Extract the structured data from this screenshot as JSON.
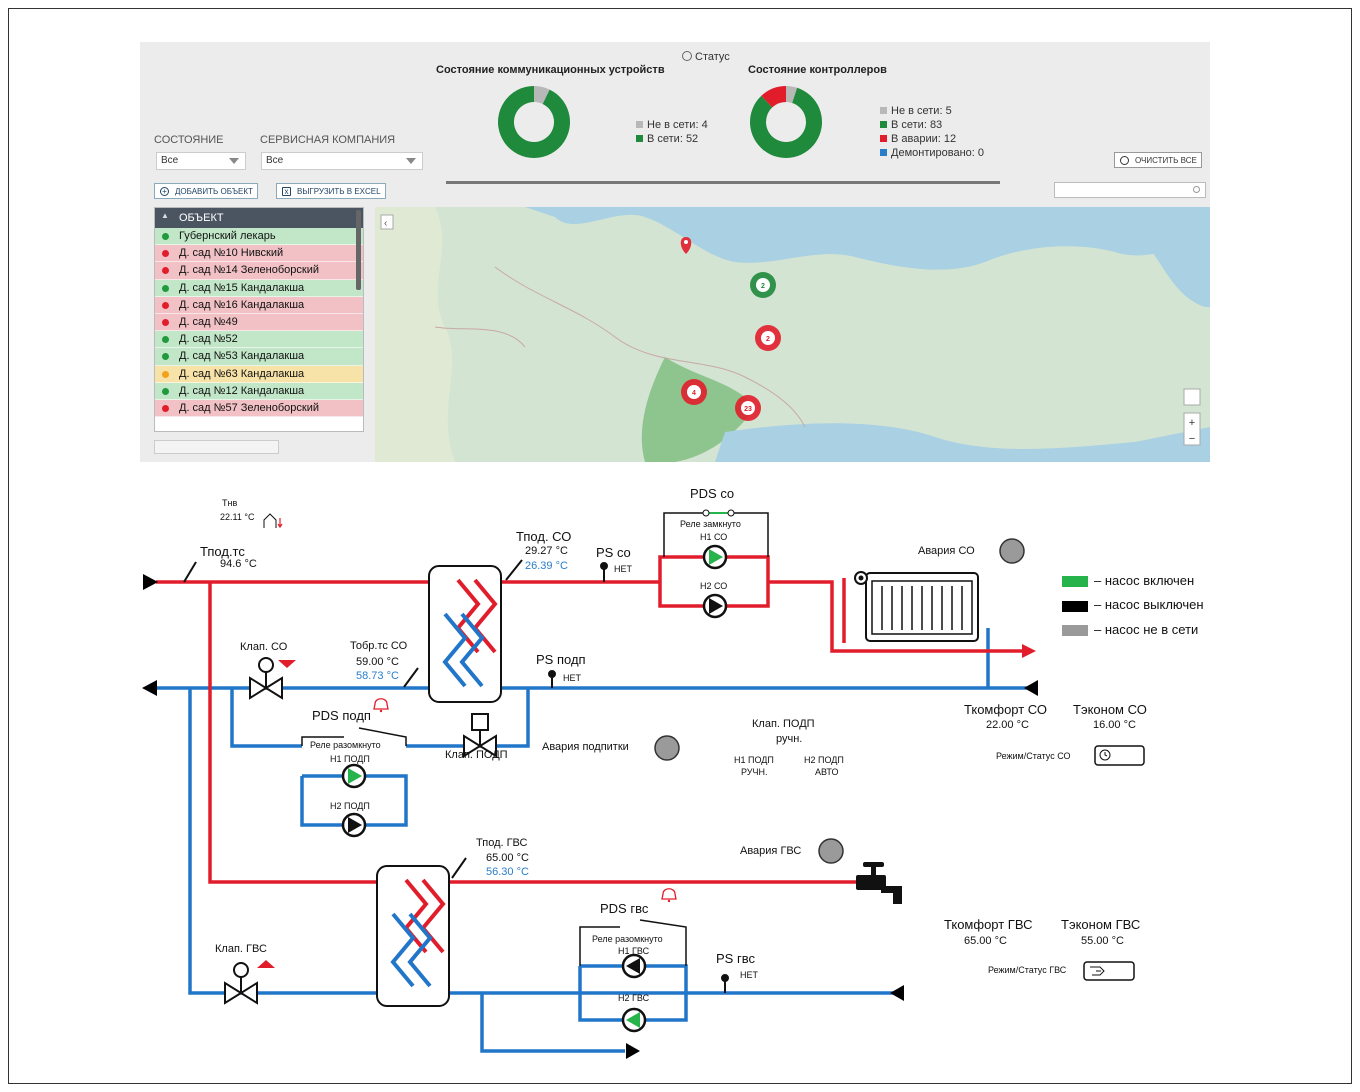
{
  "colors": {
    "supply": "#e21d2b",
    "return": "#2176c9",
    "pump_on": "#27b34b",
    "pump_off": "#000000",
    "pump_offline": "#9a9a9a",
    "alarm_indicator": "#9a9a9a"
  },
  "dashboard": {
    "status_title": "Статус",
    "comm_devices": {
      "title": "Состояние коммуникационных устройств",
      "offline_label": "Не в сети: 4",
      "online_label": "В сети: 52"
    },
    "controllers": {
      "title": "Состояние контроллеров",
      "offline_label": "Не в сети: 5",
      "online_label": "В сети: 83",
      "alarm_label": "В аварии: 12",
      "dismantled_label": "Демонтировано: 0"
    },
    "chart_data": [
      {
        "type": "pie",
        "title": "Состояние коммуникационных устройств",
        "categories": [
          "Не в сети",
          "В сети"
        ],
        "values": [
          4,
          52
        ],
        "colors": [
          "#b8b8b8",
          "#1f8a3c"
        ]
      },
      {
        "type": "pie",
        "title": "Состояние контроллеров",
        "categories": [
          "Не в сети",
          "В сети",
          "В аварии",
          "Демонтировано"
        ],
        "values": [
          5,
          83,
          12,
          0
        ],
        "colors": [
          "#b8b8b8",
          "#1f8a3c",
          "#e21d2b",
          "#2a7ec8"
        ]
      }
    ],
    "filters": {
      "state_label": "СОСТОЯНИЕ",
      "state_value": "Все",
      "company_label": "СЕРВИСНАЯ КОМПАНИЯ",
      "company_value": "Все"
    },
    "add_object_button": "ДОБАВИТЬ ОБЪЕКТ",
    "export_excel_button": "ВЫГРУЗИТЬ В EXCEL",
    "clear_all_button": "ОЧИСТИТЬ ВСЕ",
    "object_column": "ОБЪЕКТ",
    "objects": [
      {
        "name": "Губернский лекарь",
        "status": "green"
      },
      {
        "name": "Д. сад №10 Нивский",
        "status": "red"
      },
      {
        "name": "Д. сад №14 Зеленоборский",
        "status": "red"
      },
      {
        "name": "Д. сад №15 Кандалакша",
        "status": "green"
      },
      {
        "name": "Д. сад №16 Кандалакша",
        "status": "red"
      },
      {
        "name": "Д. сад №49",
        "status": "red"
      },
      {
        "name": "Д. сад №52",
        "status": "green"
      },
      {
        "name": "Д. сад №53 Кандалакша",
        "status": "green"
      },
      {
        "name": "Д. сад №63 Кандалакша",
        "status": "yellow"
      },
      {
        "name": "Д. сад №12 Кандалакша",
        "status": "green"
      },
      {
        "name": "Д. сад №57 Зеленоборский",
        "status": "red"
      }
    ],
    "map_clusters": [
      {
        "count": "2",
        "status": "green"
      },
      {
        "count": "2",
        "status": "red"
      },
      {
        "count": "4",
        "status": "red"
      },
      {
        "count": "23",
        "status": "red"
      }
    ],
    "map_zoom_in": "+",
    "map_zoom_out": "−"
  },
  "schematic": {
    "tnv": {
      "label": "Тнв",
      "value": "22.11 °C"
    },
    "tpod_ts": {
      "label": "Тпод.тс",
      "value": "94.6 °C"
    },
    "tpod_co": {
      "label": "Тпод. СО",
      "value": "29.27 °C",
      "value2": "26.39 °C"
    },
    "tobr_ts_co": {
      "label": "Тобр.тс СО",
      "value": "59.00 °C",
      "value2": "58.73 °C"
    },
    "ps_co": {
      "label": "PS co",
      "value": "НЕТ"
    },
    "ps_podp": {
      "label": "PS подп",
      "value": "НЕТ"
    },
    "ps_gvs": {
      "label": "PS гвс",
      "value": "НЕТ"
    },
    "pds_co": {
      "label": "PDS co",
      "relay": "Реле замкнуто",
      "pump1": "Н1 СО",
      "pump2": "Н2 СО"
    },
    "pds_podp": {
      "label": "PDS подп",
      "relay": "Реле разомкнуто",
      "pump1": "Н1 ПОДП",
      "pump2": "Н2 ПОДП"
    },
    "pds_gvs": {
      "label": "PDS гвс",
      "relay": "Реле разомкнуто",
      "pump1": "Н1 ГВС",
      "pump2": "Н2 ГВС"
    },
    "valve_co": "Клап. СО",
    "valve_podp": "Клап. ПОДП",
    "valve_gvs": "Клап. ГВС",
    "alarm_co": "Авария СО",
    "alarm_podp": "Авария подпитки",
    "alarm_gvs": "Авария ГВС",
    "klap_podp_mode": {
      "title": "Клап. ПОДП",
      "mode": "ручн.",
      "h1_label": "Н1 ПОДП",
      "h1_mode": "РУЧН.",
      "h2_label": "Н2 ПОДП",
      "h2_mode": "АВТО"
    },
    "tpod_gvs": {
      "label": "Тпод. ГВС",
      "value": "65.00 °C",
      "value2": "56.30 °C"
    },
    "co_comfort": {
      "label": "Ткомфорт СО",
      "value": "22.00 °C"
    },
    "co_econom": {
      "label": "Тэконом СО",
      "value": "16.00 °C"
    },
    "co_mode_label": "Режим/Статус СО",
    "gvs_comfort": {
      "label": "Ткомфорт ГВС",
      "value": "65.00 °C"
    },
    "gvs_econom": {
      "label": "Тэконом ГВС",
      "value": "55.00 °C"
    },
    "gvs_mode_label": "Режим/Статус ГВС",
    "legend": {
      "on": "– насос включен",
      "off": "– насос выключен",
      "offline": "– насос не в сети"
    }
  }
}
